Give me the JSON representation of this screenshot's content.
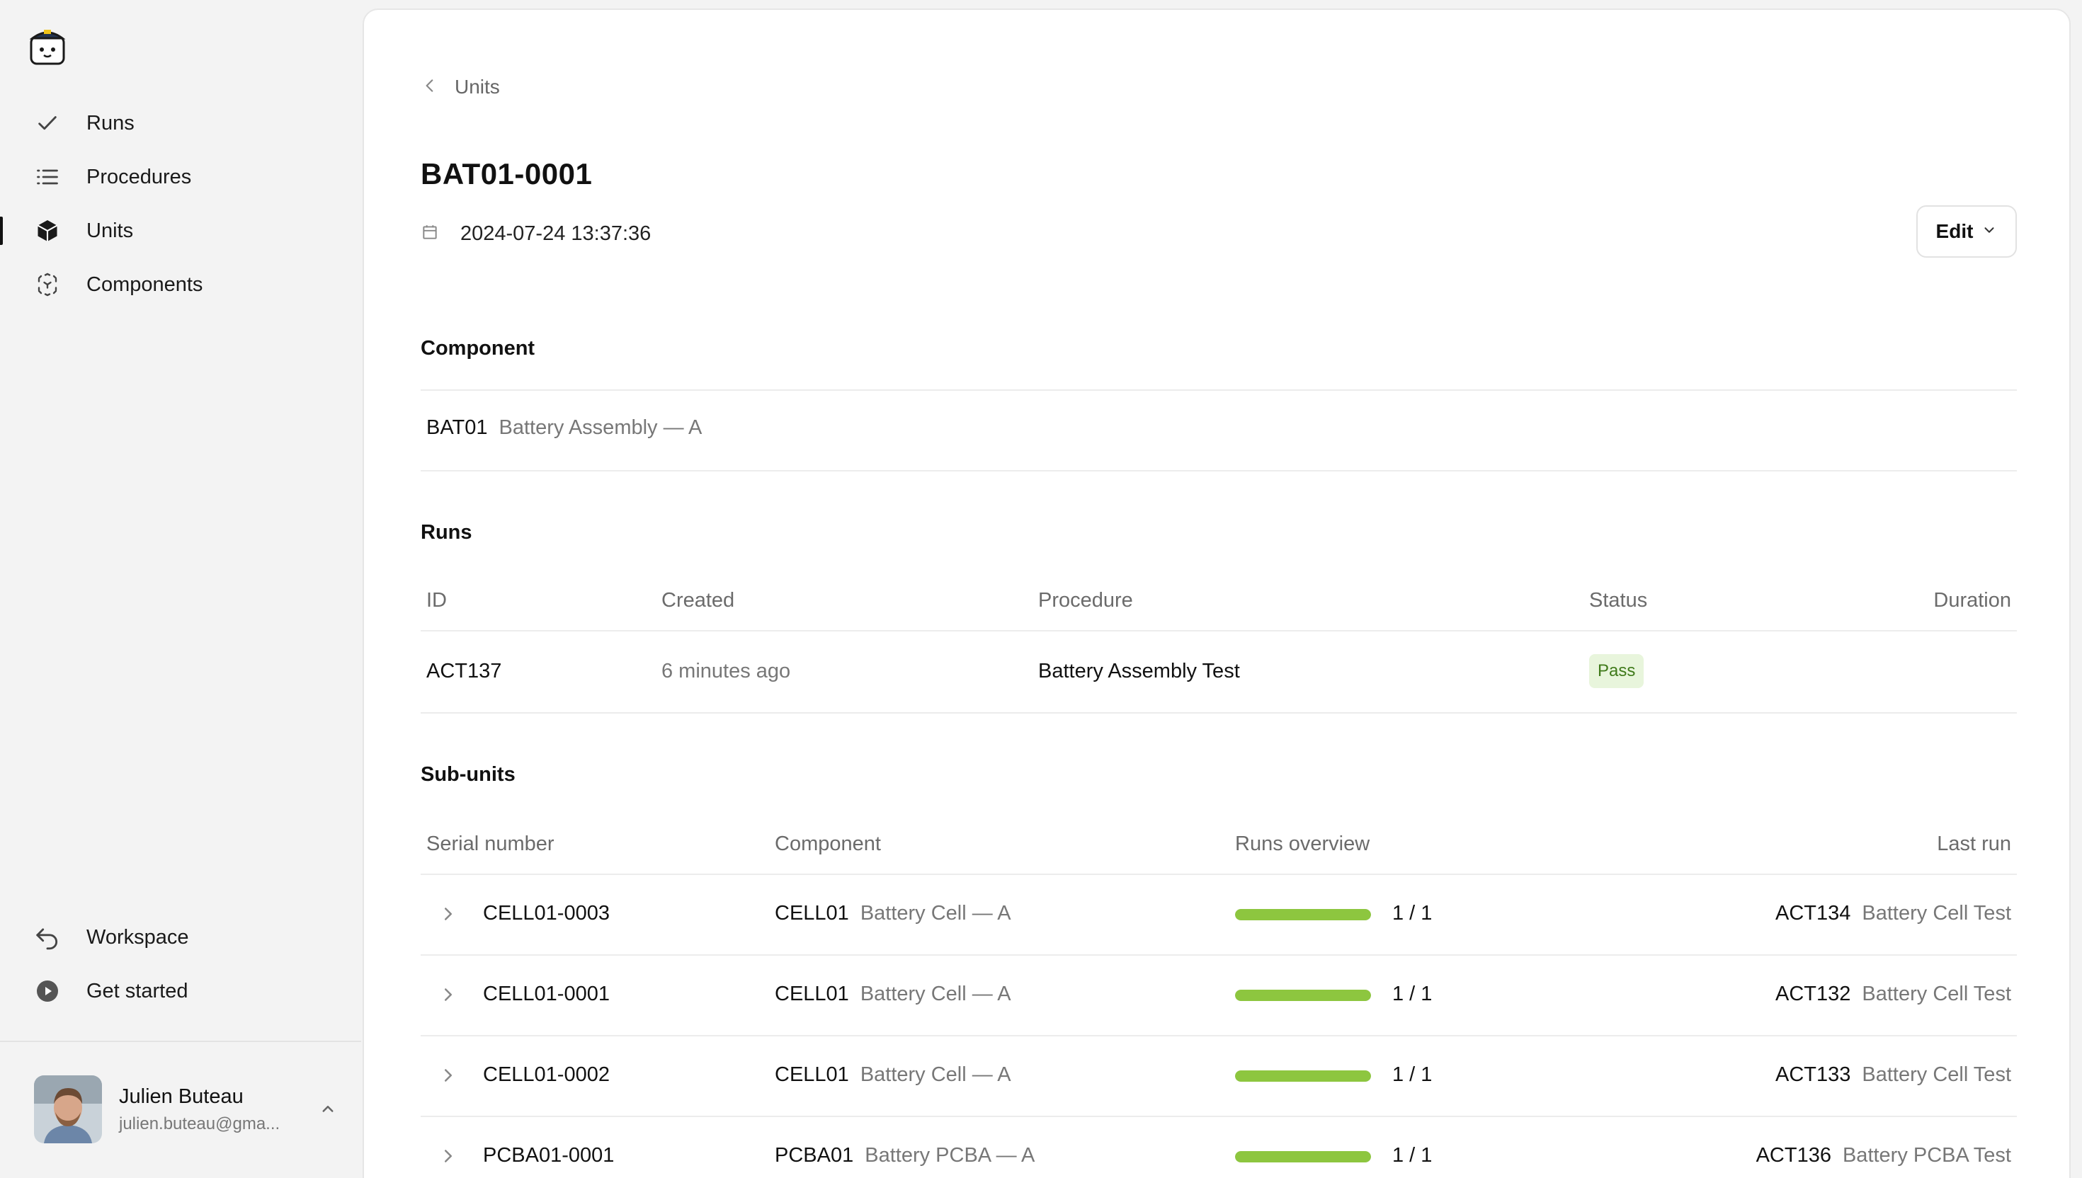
{
  "sidebar": {
    "nav": [
      {
        "label": "Runs",
        "icon": "check-icon"
      },
      {
        "label": "Procedures",
        "icon": "list-icon"
      },
      {
        "label": "Units",
        "icon": "cube-icon",
        "active": true
      },
      {
        "label": "Components",
        "icon": "component-icon"
      }
    ],
    "bottom": [
      {
        "label": "Workspace",
        "icon": "back-arrow-icon"
      },
      {
        "label": "Get started",
        "icon": "play-circle-icon"
      }
    ],
    "user": {
      "name": "Julien Buteau",
      "email": "julien.buteau@gma..."
    }
  },
  "breadcrumb": {
    "label": "Units"
  },
  "page": {
    "title": "BAT01-0001",
    "date": "2024-07-24 13:37:36",
    "edit_label": "Edit"
  },
  "component_section": {
    "title": "Component",
    "code": "BAT01",
    "name": "Battery Assembly — A"
  },
  "runs_section": {
    "title": "Runs",
    "columns": [
      "ID",
      "Created",
      "Procedure",
      "Status",
      "Duration"
    ],
    "rows": [
      {
        "id": "ACT137",
        "created": "6 minutes ago",
        "procedure": "Battery Assembly Test",
        "status": "Pass",
        "duration": ""
      }
    ]
  },
  "subunits_section": {
    "title": "Sub-units",
    "columns": [
      "Serial number",
      "Component",
      "Runs overview",
      "Last run"
    ],
    "rows": [
      {
        "serial": "CELL01-0003",
        "comp_code": "CELL01",
        "comp_name": "Battery Cell — A",
        "progress": 1.0,
        "count": "1 / 1",
        "last_id": "ACT134",
        "last_name": "Battery Cell Test"
      },
      {
        "serial": "CELL01-0001",
        "comp_code": "CELL01",
        "comp_name": "Battery Cell — A",
        "progress": 1.0,
        "count": "1 / 1",
        "last_id": "ACT132",
        "last_name": "Battery Cell Test"
      },
      {
        "serial": "CELL01-0002",
        "comp_code": "CELL01",
        "comp_name": "Battery Cell — A",
        "progress": 1.0,
        "count": "1 / 1",
        "last_id": "ACT133",
        "last_name": "Battery Cell Test"
      },
      {
        "serial": "PCBA01-0001",
        "comp_code": "PCBA01",
        "comp_name": "Battery PCBA — A",
        "progress": 1.0,
        "count": "1 / 1",
        "last_id": "ACT136",
        "last_name": "Battery PCBA Test"
      }
    ]
  },
  "colors": {
    "pass_bg": "#e8f5dc",
    "pass_text": "#3f7a1a",
    "bar": "#8dc63f"
  }
}
